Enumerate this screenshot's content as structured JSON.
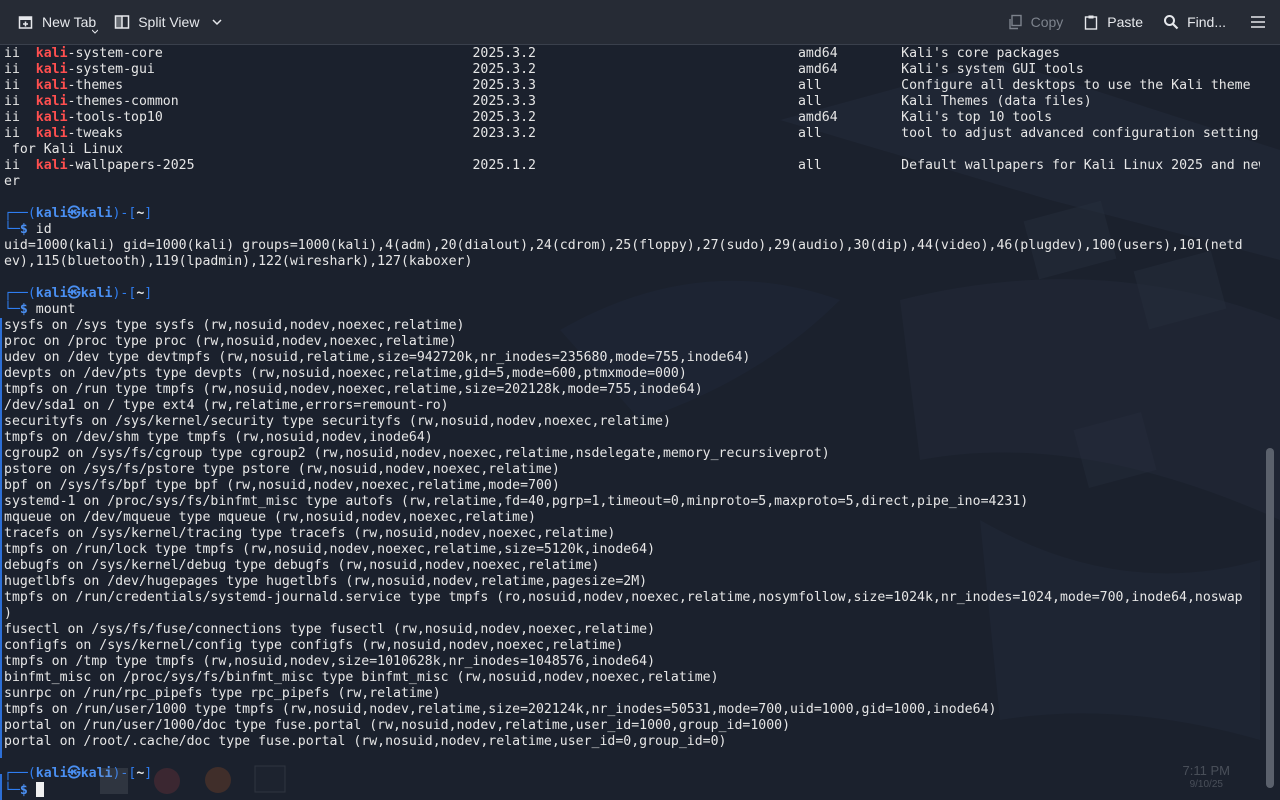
{
  "toolbar": {
    "new_tab": "New Tab",
    "split_view": "Split View",
    "copy": "Copy",
    "paste": "Paste",
    "find": "Find..."
  },
  "prompt": {
    "user": "kali",
    "host": "kali",
    "dir": "~"
  },
  "packages": [
    {
      "name": "-system-core",
      "version": "2025.3.2",
      "arch": "amd64",
      "desc": "Kali's core packages"
    },
    {
      "name": "-system-gui",
      "version": "2025.3.2",
      "arch": "amd64",
      "desc": "Kali's system GUI tools"
    },
    {
      "name": "-themes",
      "version": "2025.3.3",
      "arch": "all",
      "desc": "Configure all desktops to use the Kali theme"
    },
    {
      "name": "-themes-common",
      "version": "2025.3.3",
      "arch": "all",
      "desc": "Kali Themes (data files)"
    },
    {
      "name": "-tools-top10",
      "version": "2025.3.2",
      "arch": "amd64",
      "desc": "Kali's top 10 tools"
    },
    {
      "name": "-tweaks",
      "version": "2023.3.2",
      "arch": "all",
      "desc": "tool to adjust advanced configuration settings",
      "cont": " for Kali Linux"
    },
    {
      "name": "-wallpapers-2025",
      "version": "2025.1.2",
      "arch": "all",
      "desc": "Default wallpapers for Kali Linux 2025 and new",
      "cont": "er"
    }
  ],
  "pkg_prefix": "ii",
  "pkg_hl": "kali",
  "cmd1": "id",
  "id_output": [
    "uid=1000(kali) gid=1000(kali) groups=1000(kali),4(adm),20(dialout),24(cdrom),25(floppy),27(sudo),29(audio),30(dip),44(video),46(plugdev),100(users),101(netd",
    "ev),115(bluetooth),119(lpadmin),122(wireshark),127(kaboxer)"
  ],
  "cmd2": "mount",
  "mount_output": [
    "sysfs on /sys type sysfs (rw,nosuid,nodev,noexec,relatime)",
    "proc on /proc type proc (rw,nosuid,nodev,noexec,relatime)",
    "udev on /dev type devtmpfs (rw,nosuid,relatime,size=942720k,nr_inodes=235680,mode=755,inode64)",
    "devpts on /dev/pts type devpts (rw,nosuid,noexec,relatime,gid=5,mode=600,ptmxmode=000)",
    "tmpfs on /run type tmpfs (rw,nosuid,nodev,noexec,relatime,size=202128k,mode=755,inode64)",
    "/dev/sda1 on / type ext4 (rw,relatime,errors=remount-ro)",
    "securityfs on /sys/kernel/security type securityfs (rw,nosuid,nodev,noexec,relatime)",
    "tmpfs on /dev/shm type tmpfs (rw,nosuid,nodev,inode64)",
    "cgroup2 on /sys/fs/cgroup type cgroup2 (rw,nosuid,nodev,noexec,relatime,nsdelegate,memory_recursiveprot)",
    "pstore on /sys/fs/pstore type pstore (rw,nosuid,nodev,noexec,relatime)",
    "bpf on /sys/fs/bpf type bpf (rw,nosuid,nodev,noexec,relatime,mode=700)",
    "systemd-1 on /proc/sys/fs/binfmt_misc type autofs (rw,relatime,fd=40,pgrp=1,timeout=0,minproto=5,maxproto=5,direct,pipe_ino=4231)",
    "mqueue on /dev/mqueue type mqueue (rw,nosuid,nodev,noexec,relatime)",
    "tracefs on /sys/kernel/tracing type tracefs (rw,nosuid,nodev,noexec,relatime)",
    "tmpfs on /run/lock type tmpfs (rw,nosuid,nodev,noexec,relatime,size=5120k,inode64)",
    "debugfs on /sys/kernel/debug type debugfs (rw,nosuid,nodev,noexec,relatime)",
    "hugetlbfs on /dev/hugepages type hugetlbfs (rw,nosuid,nodev,relatime,pagesize=2M)",
    "tmpfs on /run/credentials/systemd-journald.service type tmpfs (ro,nosuid,nodev,noexec,relatime,nosymfollow,size=1024k,nr_inodes=1024,mode=700,inode64,noswap",
    ")",
    "fusectl on /sys/fs/fuse/connections type fusectl (rw,nosuid,nodev,noexec,relatime)",
    "configfs on /sys/kernel/config type configfs (rw,nosuid,nodev,noexec,relatime)",
    "tmpfs on /tmp type tmpfs (rw,nosuid,nodev,size=1010628k,nr_inodes=1048576,inode64)",
    "binfmt_misc on /proc/sys/fs/binfmt_misc type binfmt_misc (rw,nosuid,nodev,noexec,relatime)",
    "sunrpc on /run/rpc_pipefs type rpc_pipefs (rw,relatime)",
    "tmpfs on /run/user/1000 type tmpfs (rw,nosuid,nodev,relatime,size=202124k,nr_inodes=50531,mode=700,uid=1000,gid=1000,inode64)",
    "portal on /run/user/1000/doc type fuse.portal (rw,nosuid,nodev,relatime,user_id=1000,group_id=1000)",
    "portal on /root/.cache/doc type fuse.portal (rw,nosuid,nodev,relatime,user_id=0,group_id=0)"
  ],
  "clock": {
    "time": "7:11 PM",
    "date": "9/10/25"
  },
  "colors": {
    "accent": "#2f7df0",
    "highlight": "#ff4f4f",
    "background": "#1b212d"
  }
}
